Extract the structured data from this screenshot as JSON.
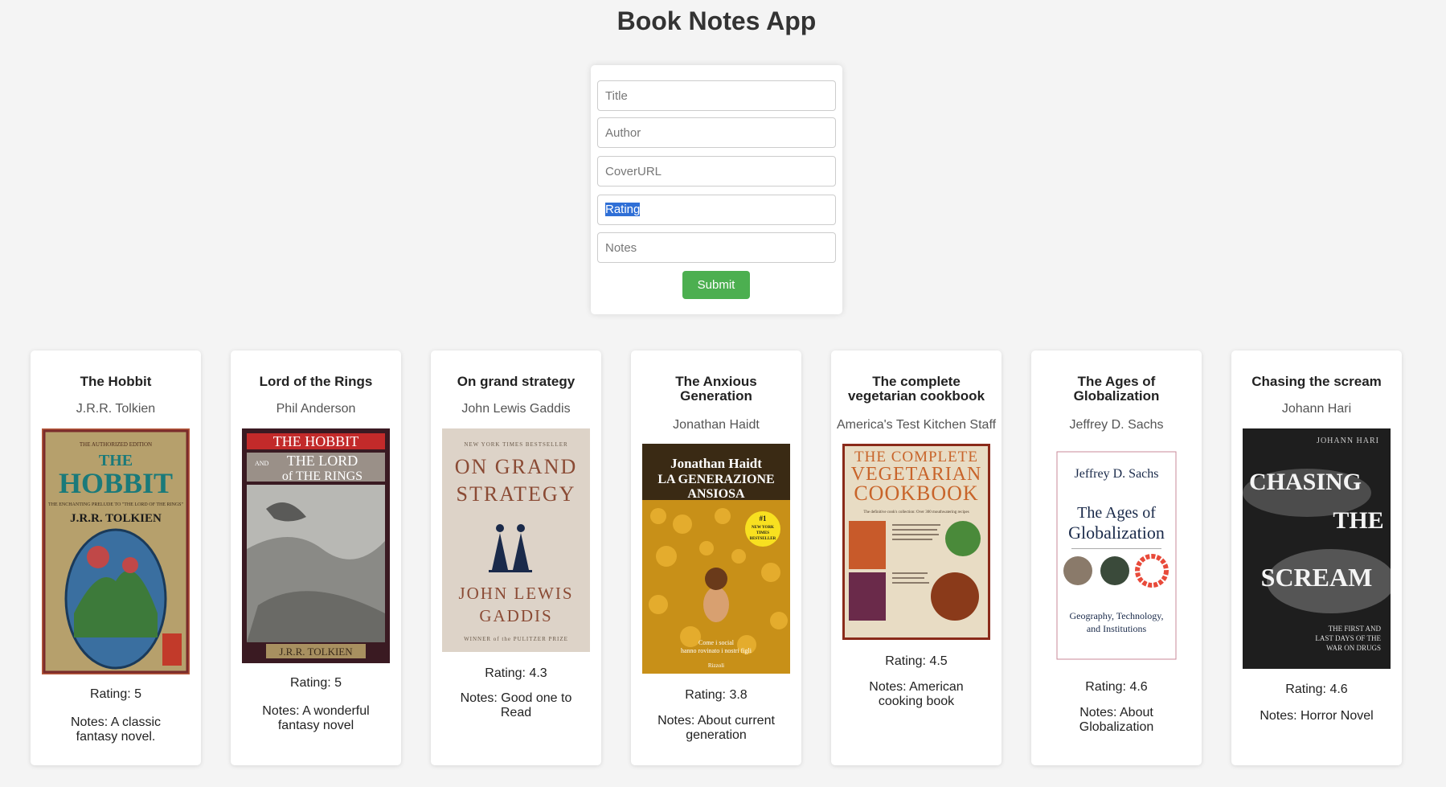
{
  "app": {
    "title": "Book Notes App"
  },
  "form": {
    "title_placeholder": "Title",
    "author_placeholder": "Author",
    "cover_placeholder": "CoverURL",
    "rating_text": "Rating",
    "notes_placeholder": "Notes",
    "submit_label": "Submit"
  },
  "books": [
    {
      "title": "The Hobbit",
      "author": "J.R.R. Tolkien",
      "rating": "Rating: 5",
      "notes": "Notes: A classic fantasy novel.",
      "cover_lines": [
        "THE AUTHORIZED EDITION",
        "THE",
        "HOBBIT",
        "THE ENCHANTING PRELUDE TO \"THE LORD OF THE RINGS\"",
        "J.R.R. TOLKIEN"
      ]
    },
    {
      "title": "Lord of the Rings",
      "author": "Phil Anderson",
      "rating": "Rating: 5",
      "notes": "Notes: A wonderful fantasy novel",
      "cover_lines": [
        "THE HOBBIT",
        "AND",
        "THE LORD",
        "of THE RINGS",
        "J.R.R. TOLKIEN"
      ]
    },
    {
      "title": "On grand strategy",
      "author": "John Lewis Gaddis",
      "rating": "Rating: 4.3",
      "notes": "Notes: Good one to Read",
      "cover_lines": [
        "NEW YORK TIMES BESTSELLER",
        "ON GRAND",
        "STRATEGY",
        "JOHN LEWIS",
        "GADDIS",
        "WINNER of the PULITZER PRIZE"
      ]
    },
    {
      "title": "The Anxious Generation",
      "author": "Jonathan Haidt",
      "rating": "Rating: 3.8",
      "notes": "Notes: About current generation",
      "cover_lines": [
        "Jonathan Haidt",
        "LA GENERAZIONE",
        "ANSIOSA",
        "#1",
        "NEW YORK",
        "TIMES",
        "BESTSELLER",
        "Come i social",
        "hanno rovinato i nostri figli",
        "Rizzoli"
      ]
    },
    {
      "title": "The complete vegetarian cookbook",
      "author": "America's Test Kitchen Staff",
      "rating": "Rating: 4.5",
      "notes": "Notes: American cooking book",
      "cover_lines": [
        "THE COMPLETE",
        "VEGETARIAN",
        "COOKBOOK",
        "The definitive cook's collection: Over 300 mouthwatering recipes"
      ]
    },
    {
      "title": "The Ages of Globalization",
      "author": "Jeffrey D. Sachs",
      "rating": "Rating: 4.6",
      "notes": "Notes: About Globalization",
      "cover_lines": [
        "Jeffrey D. Sachs",
        "The Ages of",
        "Globalization",
        "Geography, Technology,",
        "and Institutions"
      ]
    },
    {
      "title": "Chasing the scream",
      "author": "Johann Hari",
      "rating": "Rating: 4.6",
      "notes": "Notes: Horror Novel",
      "cover_lines": [
        "JOHANN HARI",
        "CHASING",
        "THE",
        "SCREAM",
        "THE FIRST AND",
        "LAST DAYS OF THE",
        "WAR ON DRUGS"
      ]
    }
  ]
}
